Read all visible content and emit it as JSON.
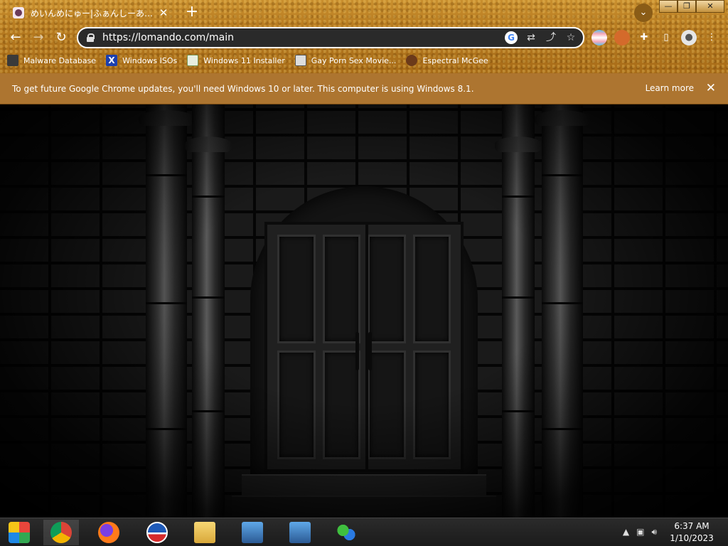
{
  "tab": {
    "title": "めいんめにゅー|ふぁんしーあいらんど",
    "close": "✕",
    "new_tab": "+"
  },
  "window_controls": {
    "minimize": "—",
    "maximize": "❐",
    "close": "✕"
  },
  "nav": {
    "back": "←",
    "forward": "→",
    "reload": "↻"
  },
  "address_bar": {
    "url": "https://lomando.com/main"
  },
  "bookmarks": [
    {
      "label": "Malware Database",
      "icon": "malware-icon"
    },
    {
      "label": "Windows ISOs",
      "icon": "x-icon"
    },
    {
      "label": "Windows 11 Installer",
      "icon": "installer-icon"
    },
    {
      "label": "Gay Porn Sex Movie...",
      "icon": "movie-icon"
    },
    {
      "label": "Espectral McGee",
      "icon": "avatar-icon"
    }
  ],
  "infobar": {
    "message": "To get future Google Chrome updates, you'll need Windows 10 or later. This computer is using Windows 8.1.",
    "learn_more": "Learn more",
    "close": "✕"
  },
  "taskbar": {
    "clock_time": "6:37 AM",
    "clock_date": "1/10/2023",
    "tray_arrow": "▲"
  },
  "colors": {
    "chrome_frame": "#b67a20",
    "infobar": "#ad7530",
    "taskbar": "#1b1b1b"
  }
}
